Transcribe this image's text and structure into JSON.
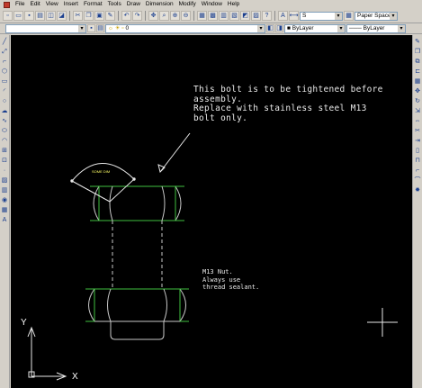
{
  "menubar": {
    "items": [
      "File",
      "Edit",
      "View",
      "Insert",
      "Format",
      "Tools",
      "Draw",
      "Dimension",
      "Modify",
      "Window",
      "Help"
    ]
  },
  "toolbar1": {
    "dimstyle_value": "S",
    "space_value": "Paper Space"
  },
  "toolbar2": {
    "layer_value": "0",
    "color_value": "ByLayer",
    "linetype_value": "ByLayer"
  },
  "drawing": {
    "note_main_lines": [
      "This bolt is to be tightened before",
      "assembly.",
      "Replace with stainless steel M13",
      "bolt only."
    ],
    "note_nut_lines": [
      "M13 Nut.",
      "Always use",
      "thread sealant."
    ],
    "angle_dim_text": "SOME DIM",
    "ucs_x_label": "X",
    "ucs_y_label": "Y"
  },
  "colors": {
    "canvas_bg": "#000000",
    "outline": "#c8c8c8",
    "green": "#3fbf3f",
    "dimension": "#ffff66",
    "ui_bg": "#d4d0c8"
  },
  "icons": {
    "left_toolbar": [
      "line-icon",
      "construction-line-icon",
      "polyline-icon",
      "polygon-icon",
      "rectangle-icon",
      "arc-icon",
      "circle-icon",
      "revision-cloud-icon",
      "spline-icon",
      "ellipse-icon",
      "ellipse-arc-icon",
      "insert-block-icon",
      "make-block-icon",
      "point-icon",
      "hatch-icon",
      "gradient-icon",
      "region-icon",
      "table-icon",
      "text-icon"
    ],
    "right_toolbar": [
      "erase-icon",
      "copy-icon",
      "mirror-icon",
      "offset-icon",
      "array-icon",
      "move-icon",
      "rotate-icon",
      "scale-icon",
      "stretch-icon",
      "trim-icon",
      "extend-icon",
      "break-icon",
      "join-icon",
      "chamfer-icon",
      "fillet-icon",
      "explode-icon"
    ]
  }
}
